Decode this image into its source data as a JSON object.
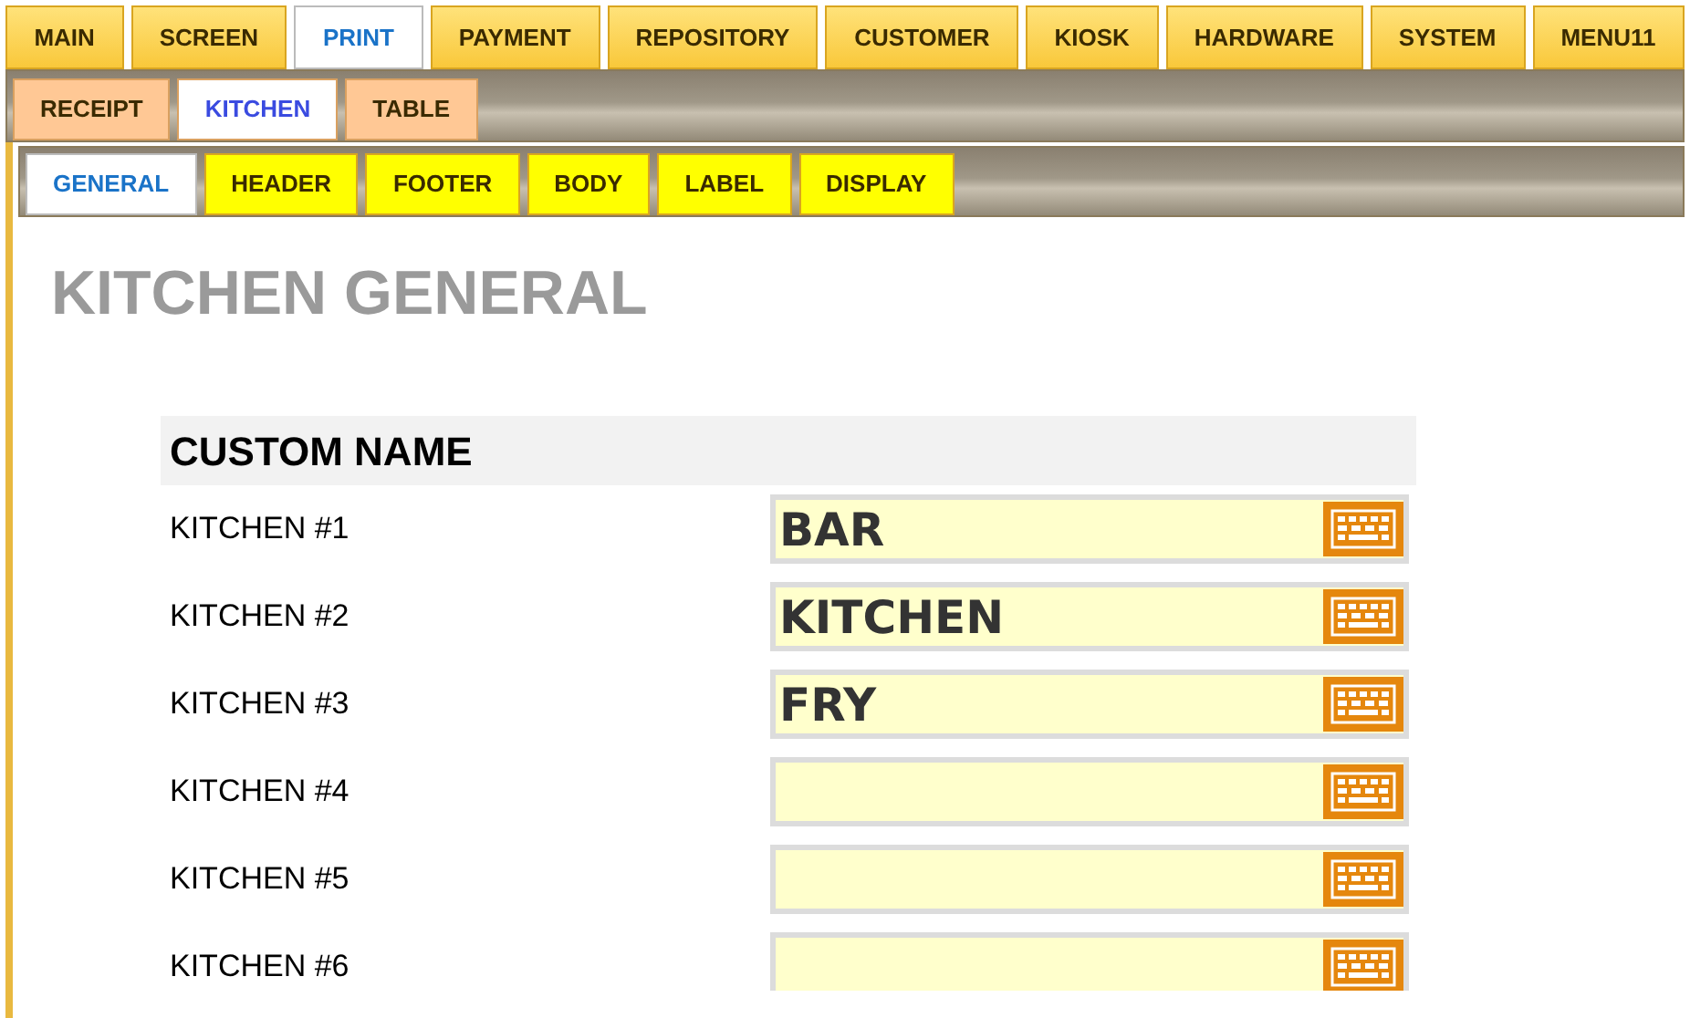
{
  "main_tabs": [
    {
      "label": "MAIN",
      "selected": false
    },
    {
      "label": "SCREEN",
      "selected": false
    },
    {
      "label": "PRINT",
      "selected": true
    },
    {
      "label": "PAYMENT",
      "selected": false
    },
    {
      "label": "REPOSITORY",
      "selected": false
    },
    {
      "label": "CUSTOMER",
      "selected": false
    },
    {
      "label": "KIOSK",
      "selected": false
    },
    {
      "label": "HARDWARE",
      "selected": false
    },
    {
      "label": "SYSTEM",
      "selected": false
    },
    {
      "label": "MENU11",
      "selected": false
    }
  ],
  "print_tabs": [
    {
      "label": "RECEIPT",
      "selected": false
    },
    {
      "label": "KITCHEN",
      "selected": true
    },
    {
      "label": "TABLE",
      "selected": false
    }
  ],
  "kitchen_tabs": [
    {
      "label": "GENERAL",
      "selected": true
    },
    {
      "label": "HEADER",
      "selected": false
    },
    {
      "label": "FOOTER",
      "selected": false
    },
    {
      "label": "BODY",
      "selected": false
    },
    {
      "label": "LABEL",
      "selected": false
    },
    {
      "label": "DISPLAY",
      "selected": false
    }
  ],
  "page_title": "KITCHEN GENERAL",
  "section": {
    "title": "CUSTOM NAME",
    "rows": [
      {
        "label": "KITCHEN #1",
        "value": "BAR"
      },
      {
        "label": "KITCHEN #2",
        "value": "KITCHEN"
      },
      {
        "label": "KITCHEN #3",
        "value": "FRY"
      },
      {
        "label": "KITCHEN #4",
        "value": ""
      },
      {
        "label": "KITCHEN #5",
        "value": ""
      },
      {
        "label": "KITCHEN #6",
        "value": ""
      }
    ]
  }
}
